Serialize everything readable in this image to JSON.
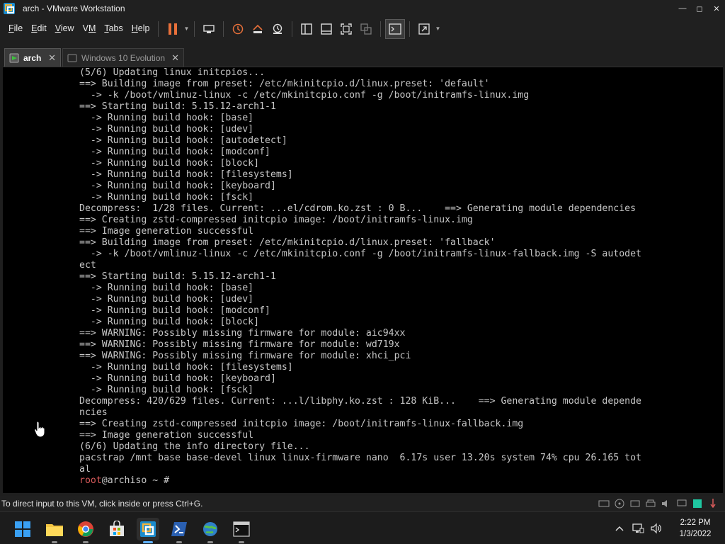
{
  "window": {
    "title": "arch - VMware Workstation"
  },
  "menu": [
    "File",
    "Edit",
    "View",
    "VM",
    "Tabs",
    "Help"
  ],
  "menu_underline": [
    "F",
    "E",
    "V",
    "M",
    "T",
    "H"
  ],
  "tabs": [
    {
      "label": "arch",
      "active": true
    },
    {
      "label": "Windows 10 Evolution",
      "active": false
    }
  ],
  "terminal": {
    "lines": [
      "(5/6) Updating linux initcpios...",
      "==> Building image from preset: /etc/mkinitcpio.d/linux.preset: 'default'",
      "  -> -k /boot/vmlinuz-linux -c /etc/mkinitcpio.conf -g /boot/initramfs-linux.img",
      "==> Starting build: 5.15.12-arch1-1",
      "  -> Running build hook: [base]",
      "  -> Running build hook: [udev]",
      "  -> Running build hook: [autodetect]",
      "  -> Running build hook: [modconf]",
      "  -> Running build hook: [block]",
      "  -> Running build hook: [filesystems]",
      "  -> Running build hook: [keyboard]",
      "  -> Running build hook: [fsck]",
      "Decompress:  1/28 files. Current: ...el/cdrom.ko.zst : 0 B...    ==> Generating module dependencies",
      "==> Creating zstd-compressed initcpio image: /boot/initramfs-linux.img",
      "==> Image generation successful",
      "==> Building image from preset: /etc/mkinitcpio.d/linux.preset: 'fallback'",
      "  -> -k /boot/vmlinuz-linux -c /etc/mkinitcpio.conf -g /boot/initramfs-linux-fallback.img -S autodet",
      "ect",
      "==> Starting build: 5.15.12-arch1-1",
      "  -> Running build hook: [base]",
      "  -> Running build hook: [udev]",
      "  -> Running build hook: [modconf]",
      "  -> Running build hook: [block]",
      "==> WARNING: Possibly missing firmware for module: aic94xx",
      "==> WARNING: Possibly missing firmware for module: wd719x",
      "==> WARNING: Possibly missing firmware for module: xhci_pci",
      "  -> Running build hook: [filesystems]",
      "  -> Running build hook: [keyboard]",
      "  -> Running build hook: [fsck]",
      "Decompress: 420/629 files. Current: ...l/libphy.ko.zst : 128 KiB...    ==> Generating module depende",
      "ncies",
      "==> Creating zstd-compressed initcpio image: /boot/initramfs-linux-fallback.img",
      "==> Image generation successful",
      "(6/6) Updating the info directory file...",
      "pacstrap /mnt base base-devel linux linux-firmware nano  6.17s user 13.20s system 74% cpu 26.165 tot",
      "al"
    ],
    "prompt_user": "root",
    "prompt_rest": "@archiso ~ #"
  },
  "status": {
    "text": "To direct input to this VM, click inside or press Ctrl+G."
  },
  "clock": {
    "time": "2:22 PM",
    "date": "1/3/2022"
  },
  "colors": {
    "prompt_red": "#d65a5a",
    "terminal_fg": "#c6c6c6",
    "terminal_bg": "#000000",
    "accent_blue": "#5fb2ff"
  }
}
